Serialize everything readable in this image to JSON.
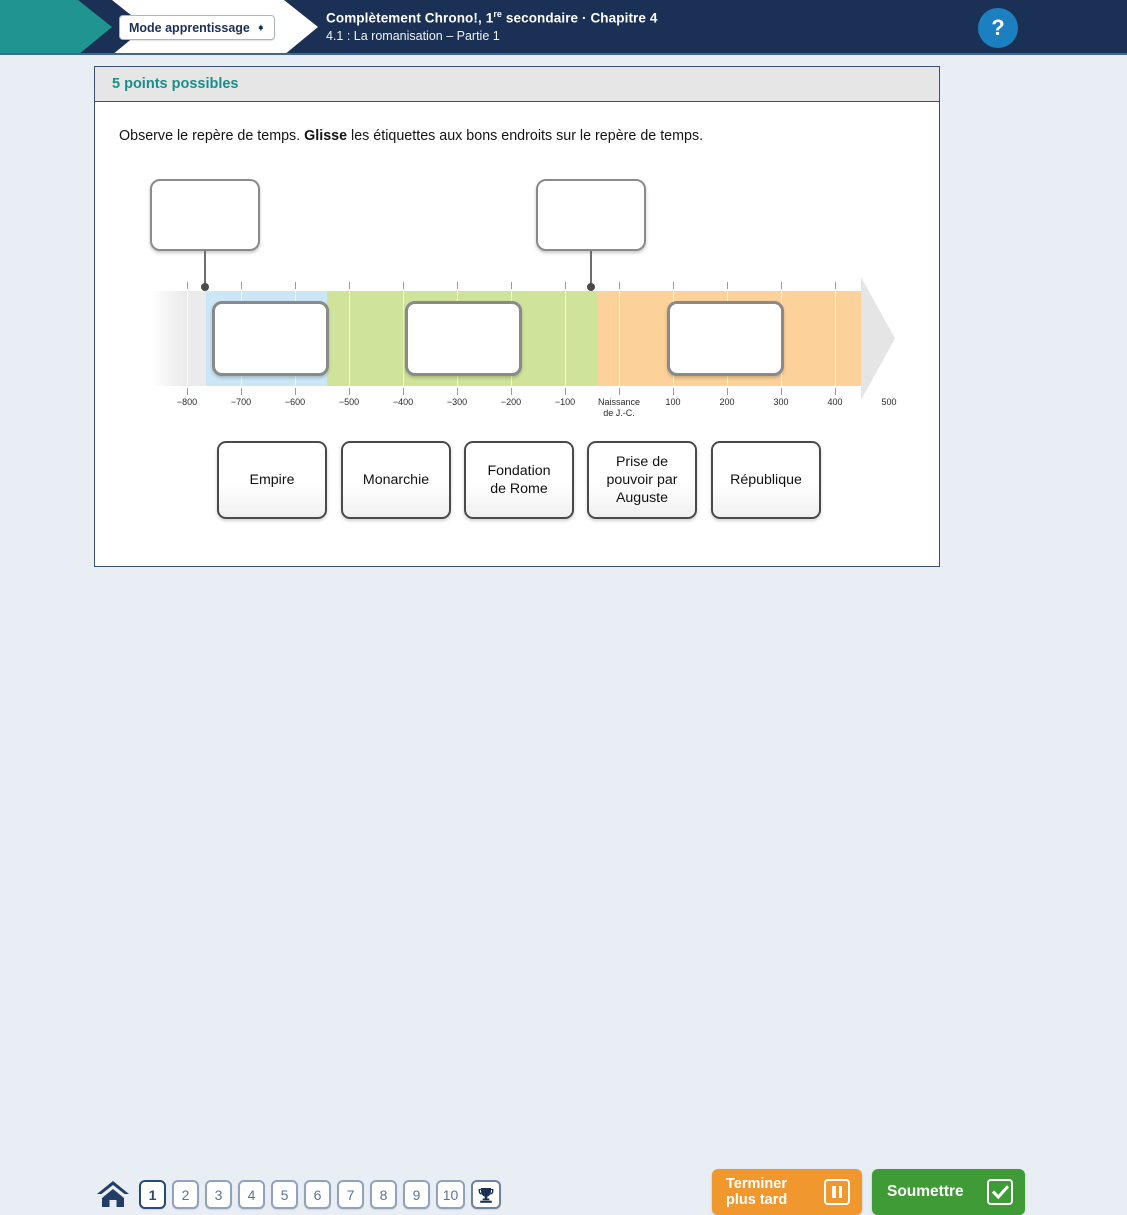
{
  "header": {
    "mode_select": {
      "label": "Mode apprentissage",
      "icon": "updown-arrows-icon"
    },
    "title_line1_pre": "Complètement Chrono!, 1",
    "title_line1_sup": "re",
    "title_line1_post": " secondaire · Chapitre 4",
    "title_line2": "4.1 : La romanisation – Partie 1",
    "help_label": "?"
  },
  "card": {
    "points_label": "5 points possibles",
    "instruction_part1": "Observe le repère de temps. ",
    "instruction_bold": "Glisse",
    "instruction_part2": " les étiquettes aux bons endroits sur le repère de temps."
  },
  "timeline": {
    "tick_labels": [
      "−800",
      "−700",
      "−600",
      "−500",
      "−400",
      "−300",
      "−200",
      "−100",
      "Naissance\nde J.-C.",
      "100",
      "200",
      "300",
      "400",
      "500"
    ],
    "tick_values": [
      -800,
      -700,
      -600,
      -500,
      -400,
      -300,
      -200,
      -100,
      0,
      100,
      200,
      300,
      400,
      500
    ],
    "segments": [
      {
        "name": "pre-fade",
        "color": "#ebebeb",
        "start": -900,
        "end": -760
      },
      {
        "name": "monarchie-period",
        "color": "#cbe7f7",
        "start": -760,
        "end": -510
      },
      {
        "name": "republique-period",
        "color": "#cfe39b",
        "start": -510,
        "end": -30
      },
      {
        "name": "empire-period",
        "color": "#fcd29a",
        "start": -30,
        "end": 480
      },
      {
        "name": "post-gray",
        "color": "#e5e5e5",
        "start": 480,
        "end": 560
      }
    ],
    "callouts": [
      {
        "name": "callout-fondation-de-rome",
        "value": -753,
        "text": ""
      },
      {
        "name": "callout-prise-de-pouvoir",
        "value": -27,
        "text": ""
      }
    ],
    "slots": [
      {
        "name": "slot-monarchie",
        "text": ""
      },
      {
        "name": "slot-republique",
        "text": ""
      },
      {
        "name": "slot-empire",
        "text": ""
      }
    ]
  },
  "drag_cards": [
    {
      "label": "Empire",
      "name": "drag-card-empire"
    },
    {
      "label": "Monarchie",
      "name": "drag-card-monarchie"
    },
    {
      "label": "Fondation\nde Rome",
      "name": "drag-card-fondation-de-rome"
    },
    {
      "label": "Prise de\npouvoir par\nAuguste",
      "name": "drag-card-prise-de-pouvoir"
    },
    {
      "label": "République",
      "name": "drag-card-republique"
    }
  ],
  "footer": {
    "home_icon": "home-icon",
    "pages": [
      "1",
      "2",
      "3",
      "4",
      "5",
      "6",
      "7",
      "8",
      "9",
      "10"
    ],
    "active_page": "1",
    "trophy_icon": "trophy-icon",
    "later_line1": "Terminer",
    "later_line2": "plus tard",
    "later_icon": "pause-icon",
    "submit_label": "Soumettre",
    "submit_icon": "check-box-icon"
  },
  "colors": {
    "header_bg": "#1b3055",
    "teal": "#1f9490",
    "page_bg": "#e8eef3",
    "accent_teal_text": "#1a8f8a",
    "orange": "#f0982d",
    "green": "#3e9b36",
    "help_blue": "#1b7fc0"
  }
}
